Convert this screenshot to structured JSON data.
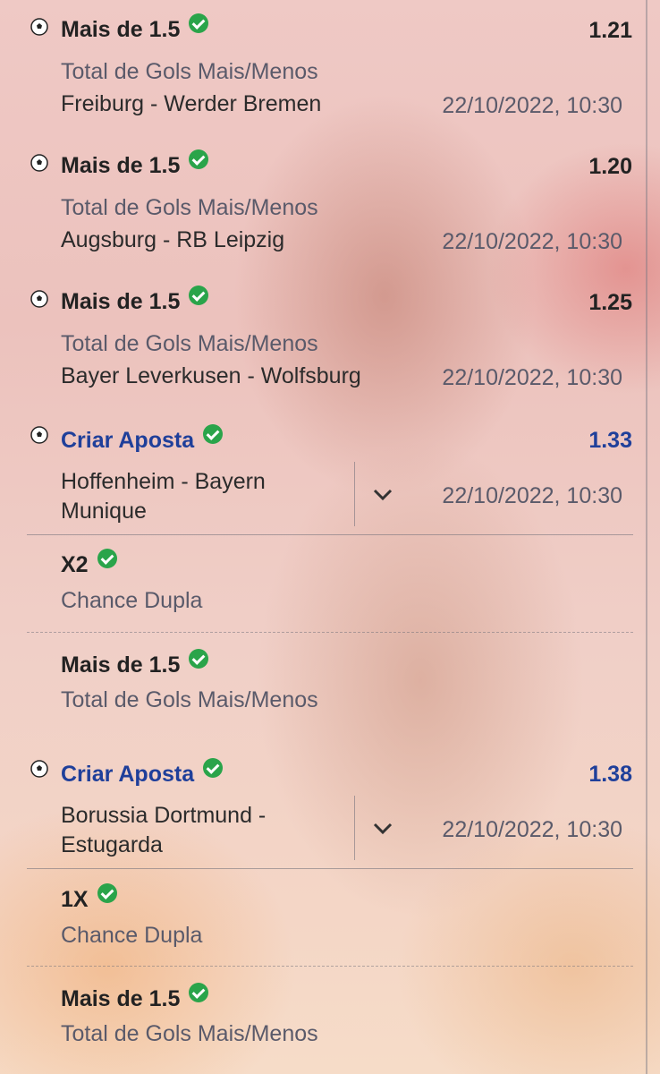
{
  "bets": [
    {
      "market": "Mais de 1.5",
      "odds": "1.21",
      "sub": "Total de Gols Mais/Menos",
      "match": "Freiburg - Werder Bremen",
      "date": "22/10/2022, 10:30"
    },
    {
      "market": "Mais de 1.5",
      "odds": "1.20",
      "sub": "Total de Gols Mais/Menos",
      "match": "Augsburg - RB Leipzig",
      "date": "22/10/2022, 10:30"
    },
    {
      "market": "Mais de 1.5",
      "odds": "1.25",
      "sub": "Total de Gols Mais/Menos",
      "match": "Bayer Leverkusen - Wolfsburg",
      "date": "22/10/2022, 10:30"
    }
  ],
  "builders": [
    {
      "title": "Criar Aposta",
      "odds": "1.33",
      "match_line1": "Hoffenheim - Bayern",
      "match_line2": "Munique",
      "date": "22/10/2022, 10:30",
      "legs": [
        {
          "market": "X2",
          "sub": "Chance Dupla"
        },
        {
          "market": "Mais de 1.5",
          "sub": "Total de Gols Mais/Menos"
        }
      ]
    },
    {
      "title": "Criar Aposta",
      "odds": "1.38",
      "match_line1": "Borussia Dortmund -",
      "match_line2": "Estugarda",
      "date": "22/10/2022, 10:30",
      "legs": [
        {
          "market": "1X",
          "sub": "Chance Dupla"
        },
        {
          "market": "Mais de 1.5",
          "sub": "Total de Gols Mais/Menos"
        }
      ]
    }
  ],
  "colors": {
    "accent_blue": "#1f3f9a",
    "check_green": "#2aa44a"
  },
  "icons": {
    "ball": "soccer-ball-icon",
    "check": "check-circle-icon",
    "expand": "chevron-down-icon"
  }
}
